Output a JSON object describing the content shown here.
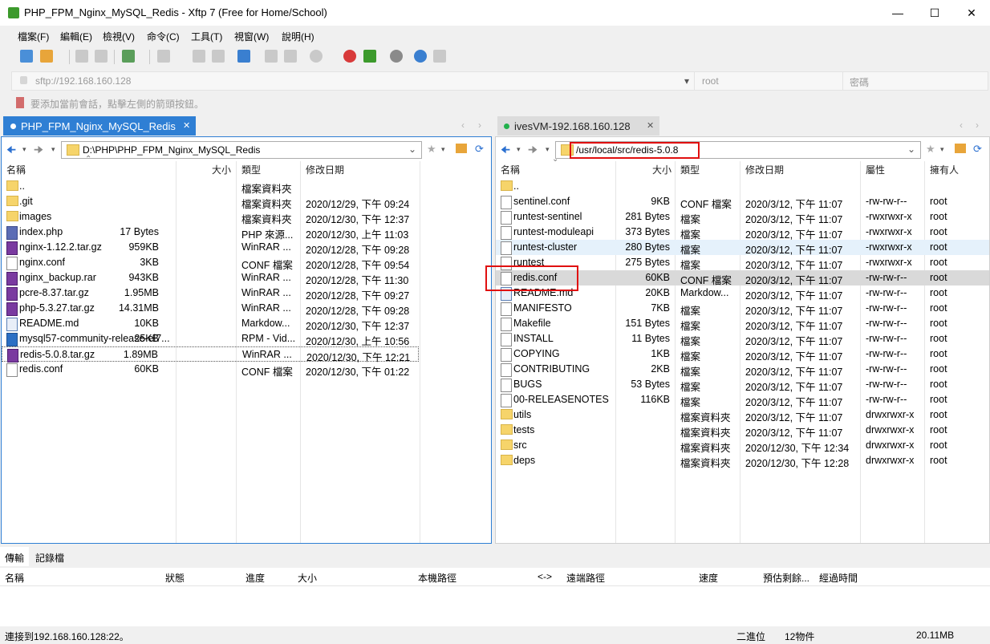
{
  "window": {
    "title": "PHP_FPM_Nginx_MySQL_Redis - Xftp 7 (Free for Home/School)"
  },
  "menu": [
    "檔案(F)",
    "編輯(E)",
    "檢視(V)",
    "命令(C)",
    "工具(T)",
    "視窗(W)",
    "說明(H)"
  ],
  "address": {
    "host": "sftp://192.168.160.128",
    "user_placeholder": "root",
    "password_placeholder": "密碼"
  },
  "hint": "要添加當前會話，點擊左側的箭頭按鈕。",
  "left": {
    "tab": "PHP_FPM_Nginx_MySQL_Redis",
    "path": "D:\\PHP\\PHP_FPM_Nginx_MySQL_Redis",
    "headers": {
      "name": "名稱",
      "size": "大小",
      "type": "類型",
      "modified": "修改日期"
    },
    "files": [
      {
        "name": "..",
        "size": "",
        "type": "檔案資料夾",
        "date": "",
        "icon": "folder"
      },
      {
        "name": ".git",
        "size": "",
        "type": "檔案資料夾",
        "date": "2020/12/29, 下午 09:24",
        "icon": "folder"
      },
      {
        "name": "images",
        "size": "",
        "type": "檔案資料夾",
        "date": "2020/12/30, 下午 12:37",
        "icon": "folder"
      },
      {
        "name": "index.php",
        "size": "17 Bytes",
        "type": "PHP 來源...",
        "date": "2020/12/30, 上午 11:03",
        "icon": "php"
      },
      {
        "name": "nginx-1.12.2.tar.gz",
        "size": "959KB",
        "type": "WinRAR ...",
        "date": "2020/12/28, 下午 09:28",
        "icon": "rar"
      },
      {
        "name": "nginx.conf",
        "size": "3KB",
        "type": "CONF 檔案",
        "date": "2020/12/28, 下午 09:54",
        "icon": "file"
      },
      {
        "name": "nginx_backup.rar",
        "size": "943KB",
        "type": "WinRAR ...",
        "date": "2020/12/28, 下午 11:30",
        "icon": "rar"
      },
      {
        "name": "pcre-8.37.tar.gz",
        "size": "1.95MB",
        "type": "WinRAR ...",
        "date": "2020/12/28, 下午 09:27",
        "icon": "rar"
      },
      {
        "name": "php-5.3.27.tar.gz",
        "size": "14.31MB",
        "type": "WinRAR ...",
        "date": "2020/12/28, 下午 09:28",
        "icon": "rar"
      },
      {
        "name": "README.md",
        "size": "10KB",
        "type": "Markdow...",
        "date": "2020/12/30, 下午 12:37",
        "icon": "md"
      },
      {
        "name": "mysql57-community-release-el7...",
        "size": "25KB",
        "type": "RPM - Vid...",
        "date": "2020/12/30, 上午 10:56",
        "icon": "rpm"
      },
      {
        "name": "redis-5.0.8.tar.gz",
        "size": "1.89MB",
        "type": "WinRAR ...",
        "date": "2020/12/30, 下午 12:21",
        "icon": "rar"
      },
      {
        "name": "redis.conf",
        "size": "60KB",
        "type": "CONF 檔案",
        "date": "2020/12/30, 下午 01:22",
        "icon": "file"
      }
    ]
  },
  "right": {
    "tab": "ivesVM-192.168.160.128",
    "path": "/usr/local/src/redis-5.0.8",
    "headers": {
      "name": "名稱",
      "size": "大小",
      "type": "類型",
      "modified": "修改日期",
      "attr": "屬性",
      "owner": "擁有人"
    },
    "files": [
      {
        "name": "..",
        "size": "",
        "type": "",
        "date": "",
        "attr": "",
        "owner": "",
        "icon": "folder"
      },
      {
        "name": "sentinel.conf",
        "size": "9KB",
        "type": "CONF 檔案",
        "date": "2020/3/12, 下午 11:07",
        "attr": "-rw-rw-r--",
        "owner": "root",
        "icon": "file"
      },
      {
        "name": "runtest-sentinel",
        "size": "281 Bytes",
        "type": "檔案",
        "date": "2020/3/12, 下午 11:07",
        "attr": "-rwxrwxr-x",
        "owner": "root",
        "icon": "file"
      },
      {
        "name": "runtest-moduleapi",
        "size": "373 Bytes",
        "type": "檔案",
        "date": "2020/3/12, 下午 11:07",
        "attr": "-rwxrwxr-x",
        "owner": "root",
        "icon": "file"
      },
      {
        "name": "runtest-cluster",
        "size": "280 Bytes",
        "type": "檔案",
        "date": "2020/3/12, 下午 11:07",
        "attr": "-rwxrwxr-x",
        "owner": "root",
        "icon": "file"
      },
      {
        "name": "runtest",
        "size": "275 Bytes",
        "type": "檔案",
        "date": "2020/3/12, 下午 11:07",
        "attr": "-rwxrwxr-x",
        "owner": "root",
        "icon": "file"
      },
      {
        "name": "redis.conf",
        "size": "60KB",
        "type": "CONF 檔案",
        "date": "2020/3/12, 下午 11:07",
        "attr": "-rw-rw-r--",
        "owner": "root",
        "icon": "file"
      },
      {
        "name": "README.md",
        "size": "20KB",
        "type": "Markdow...",
        "date": "2020/3/12, 下午 11:07",
        "attr": "-rw-rw-r--",
        "owner": "root",
        "icon": "md"
      },
      {
        "name": "MANIFESTO",
        "size": "7KB",
        "type": "檔案",
        "date": "2020/3/12, 下午 11:07",
        "attr": "-rw-rw-r--",
        "owner": "root",
        "icon": "file"
      },
      {
        "name": "Makefile",
        "size": "151 Bytes",
        "type": "檔案",
        "date": "2020/3/12, 下午 11:07",
        "attr": "-rw-rw-r--",
        "owner": "root",
        "icon": "file"
      },
      {
        "name": "INSTALL",
        "size": "11 Bytes",
        "type": "檔案",
        "date": "2020/3/12, 下午 11:07",
        "attr": "-rw-rw-r--",
        "owner": "root",
        "icon": "file"
      },
      {
        "name": "COPYING",
        "size": "1KB",
        "type": "檔案",
        "date": "2020/3/12, 下午 11:07",
        "attr": "-rw-rw-r--",
        "owner": "root",
        "icon": "file"
      },
      {
        "name": "CONTRIBUTING",
        "size": "2KB",
        "type": "檔案",
        "date": "2020/3/12, 下午 11:07",
        "attr": "-rw-rw-r--",
        "owner": "root",
        "icon": "file"
      },
      {
        "name": "BUGS",
        "size": "53 Bytes",
        "type": "檔案",
        "date": "2020/3/12, 下午 11:07",
        "attr": "-rw-rw-r--",
        "owner": "root",
        "icon": "file"
      },
      {
        "name": "00-RELEASENOTES",
        "size": "116KB",
        "type": "檔案",
        "date": "2020/3/12, 下午 11:07",
        "attr": "-rw-rw-r--",
        "owner": "root",
        "icon": "file"
      },
      {
        "name": "utils",
        "size": "",
        "type": "檔案資料夾",
        "date": "2020/3/12, 下午 11:07",
        "attr": "drwxrwxr-x",
        "owner": "root",
        "icon": "folder"
      },
      {
        "name": "tests",
        "size": "",
        "type": "檔案資料夾",
        "date": "2020/3/12, 下午 11:07",
        "attr": "drwxrwxr-x",
        "owner": "root",
        "icon": "folder"
      },
      {
        "name": "src",
        "size": "",
        "type": "檔案資料夾",
        "date": "2020/12/30, 下午 12:34",
        "attr": "drwxrwxr-x",
        "owner": "root",
        "icon": "folder"
      },
      {
        "name": "deps",
        "size": "",
        "type": "檔案資料夾",
        "date": "2020/12/30, 下午 12:28",
        "attr": "drwxrwxr-x",
        "owner": "root",
        "icon": "folder"
      }
    ]
  },
  "transfer": {
    "tabs": [
      "傳輸",
      "記錄檔"
    ],
    "headers": [
      "名稱",
      "狀態",
      "進度",
      "大小",
      "本機路徑",
      "<->",
      "遠端路徑",
      "速度",
      "預估剩餘...",
      "經過時間"
    ]
  },
  "status": {
    "connection": "連接到192.168.160.128:22。",
    "mode": "二進位",
    "count": "12物件",
    "size": "20.11MB"
  }
}
